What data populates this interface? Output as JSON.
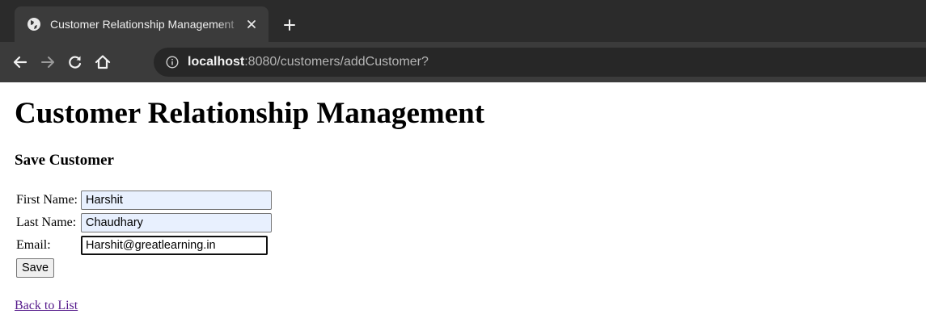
{
  "browser": {
    "tab_title": "Customer Relationship Management",
    "url_host": "localhost",
    "url_path": ":8080/customers/addCustomer?"
  },
  "page": {
    "heading": "Customer Relationship Management",
    "subheading": "Save Customer"
  },
  "form": {
    "first_name_label": "First Name:",
    "first_name_value": "Harshit",
    "last_name_label": "Last Name:",
    "last_name_value": "Chaudhary",
    "email_label": "Email:",
    "email_value": "Harshit@greatlearning.in",
    "save_label": "Save"
  },
  "links": {
    "back_to_list": "Back to List"
  },
  "colors": {
    "chrome_dark": "#2b2b2b",
    "chrome_tab": "#3b3b3b",
    "omnibox": "#272727",
    "autofill_bg": "#e8f0fe",
    "visited_link": "#551a8b"
  },
  "icons": [
    "globe-icon",
    "close-icon",
    "plus-icon",
    "back-arrow-icon",
    "forward-arrow-icon",
    "reload-icon",
    "home-icon",
    "info-icon"
  ]
}
